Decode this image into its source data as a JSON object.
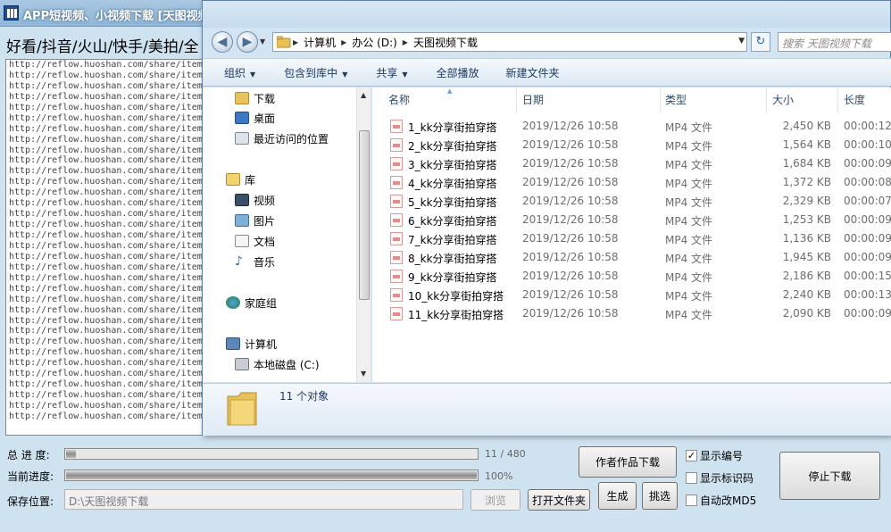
{
  "app": {
    "title": "APP短视频、小视频下载 [天图视频批",
    "platforms": "好看/抖音/火山/快手/美拍/全",
    "url_lines": [
      "http://reflow.huoshan.com/share/item",
      "http://reflow.huoshan.com/share/item",
      "http://reflow.huoshan.com/share/item",
      "http://reflow.huoshan.com/share/item",
      "http://reflow.huoshan.com/share/item",
      "http://reflow.huoshan.com/share/item",
      "http://reflow.huoshan.com/share/item",
      "http://reflow.huoshan.com/share/item",
      "http://reflow.huoshan.com/share/item",
      "http://reflow.huoshan.com/share/item",
      "http://reflow.huoshan.com/share/item",
      "http://reflow.huoshan.com/share/item",
      "http://reflow.huoshan.com/share/item",
      "http://reflow.huoshan.com/share/item",
      "http://reflow.huoshan.com/share/item",
      "http://reflow.huoshan.com/share/item",
      "http://reflow.huoshan.com/share/item",
      "http://reflow.huoshan.com/share/item",
      "http://reflow.huoshan.com/share/item",
      "http://reflow.huoshan.com/share/item",
      "http://reflow.huoshan.com/share/item",
      "http://reflow.huoshan.com/share/item",
      "http://reflow.huoshan.com/share/item",
      "http://reflow.huoshan.com/share/item",
      "http://reflow.huoshan.com/share/item",
      "http://reflow.huoshan.com/share/item",
      "http://reflow.huoshan.com/share/item",
      "http://reflow.huoshan.com/share/item",
      "http://reflow.huoshan.com/share/item",
      "http://reflow.huoshan.com/share/item",
      "http://reflow.huoshan.com/share/item",
      "http://reflow.huoshan.com/share/item",
      "http://reflow.huoshan.com/share/item",
      "http://reflow.huoshan.com/share/item"
    ],
    "total_progress_label": "总 进 度:",
    "total_progress_text": "11 / 480",
    "total_progress_fraction": 0.023,
    "current_progress_label": "当前进度:",
    "current_progress_text": "100%",
    "current_progress_fraction": 1.0,
    "save_label": "保存位置:",
    "save_path": "D:\\天图视频下载",
    "browse_label": "浏览",
    "open_folder_label": "打开文件夹",
    "author_download_label": "作者作品下载",
    "generate_label": "生成",
    "pick_label": "挑选",
    "stop_label": "停止下载",
    "checkboxes": [
      {
        "label": "显示编号",
        "checked": true
      },
      {
        "label": "显示标识码",
        "checked": false
      },
      {
        "label": "自动改MD5",
        "checked": false
      }
    ]
  },
  "explorer": {
    "breadcrumbs": [
      "计算机",
      "办公 (D:)",
      "天图视频下载"
    ],
    "search_placeholder": "搜索 天图视频下载",
    "toolbar": [
      {
        "label": "组织",
        "dropdown": true
      },
      {
        "label": "包含到库中",
        "dropdown": true
      },
      {
        "label": "共享",
        "dropdown": true
      },
      {
        "label": "全部播放",
        "dropdown": false
      },
      {
        "label": "新建文件夹",
        "dropdown": false
      }
    ],
    "nav": {
      "downloads": "下载",
      "desktop": "桌面",
      "recent": "最近访问的位置",
      "libraries": "库",
      "videos": "视频",
      "pictures": "图片",
      "documents": "文档",
      "music": "音乐",
      "homegroup": "家庭组",
      "computer": "计算机",
      "local_disk": "本地磁盘 (C:)"
    },
    "columns": [
      "名称",
      "日期",
      "类型",
      "大小",
      "长度"
    ],
    "files": [
      {
        "name": "1_kk分享街拍穿搭",
        "date": "2019/12/26 10:58",
        "type": "MP4 文件",
        "size": "2,450 KB",
        "length": "00:00:12"
      },
      {
        "name": "2_kk分享街拍穿搭",
        "date": "2019/12/26 10:58",
        "type": "MP4 文件",
        "size": "1,564 KB",
        "length": "00:00:10"
      },
      {
        "name": "3_kk分享街拍穿搭",
        "date": "2019/12/26 10:58",
        "type": "MP4 文件",
        "size": "1,684 KB",
        "length": "00:00:09"
      },
      {
        "name": "4_kk分享街拍穿搭",
        "date": "2019/12/26 10:58",
        "type": "MP4 文件",
        "size": "1,372 KB",
        "length": "00:00:08"
      },
      {
        "name": "5_kk分享街拍穿搭",
        "date": "2019/12/26 10:58",
        "type": "MP4 文件",
        "size": "2,329 KB",
        "length": "00:00:07"
      },
      {
        "name": "6_kk分享街拍穿搭",
        "date": "2019/12/26 10:58",
        "type": "MP4 文件",
        "size": "1,253 KB",
        "length": "00:00:09"
      },
      {
        "name": "7_kk分享街拍穿搭",
        "date": "2019/12/26 10:58",
        "type": "MP4 文件",
        "size": "1,136 KB",
        "length": "00:00:09"
      },
      {
        "name": "8_kk分享街拍穿搭",
        "date": "2019/12/26 10:58",
        "type": "MP4 文件",
        "size": "1,945 KB",
        "length": "00:00:09"
      },
      {
        "name": "9_kk分享街拍穿搭",
        "date": "2019/12/26 10:58",
        "type": "MP4 文件",
        "size": "2,186 KB",
        "length": "00:00:15"
      },
      {
        "name": "10_kk分享街拍穿搭",
        "date": "2019/12/26 10:58",
        "type": "MP4 文件",
        "size": "2,240 KB",
        "length": "00:00:13"
      },
      {
        "name": "11_kk分享街拍穿搭",
        "date": "2019/12/26 10:58",
        "type": "MP4 文件",
        "size": "2,090 KB",
        "length": "00:00:09"
      }
    ],
    "object_count": "11 个对象"
  }
}
